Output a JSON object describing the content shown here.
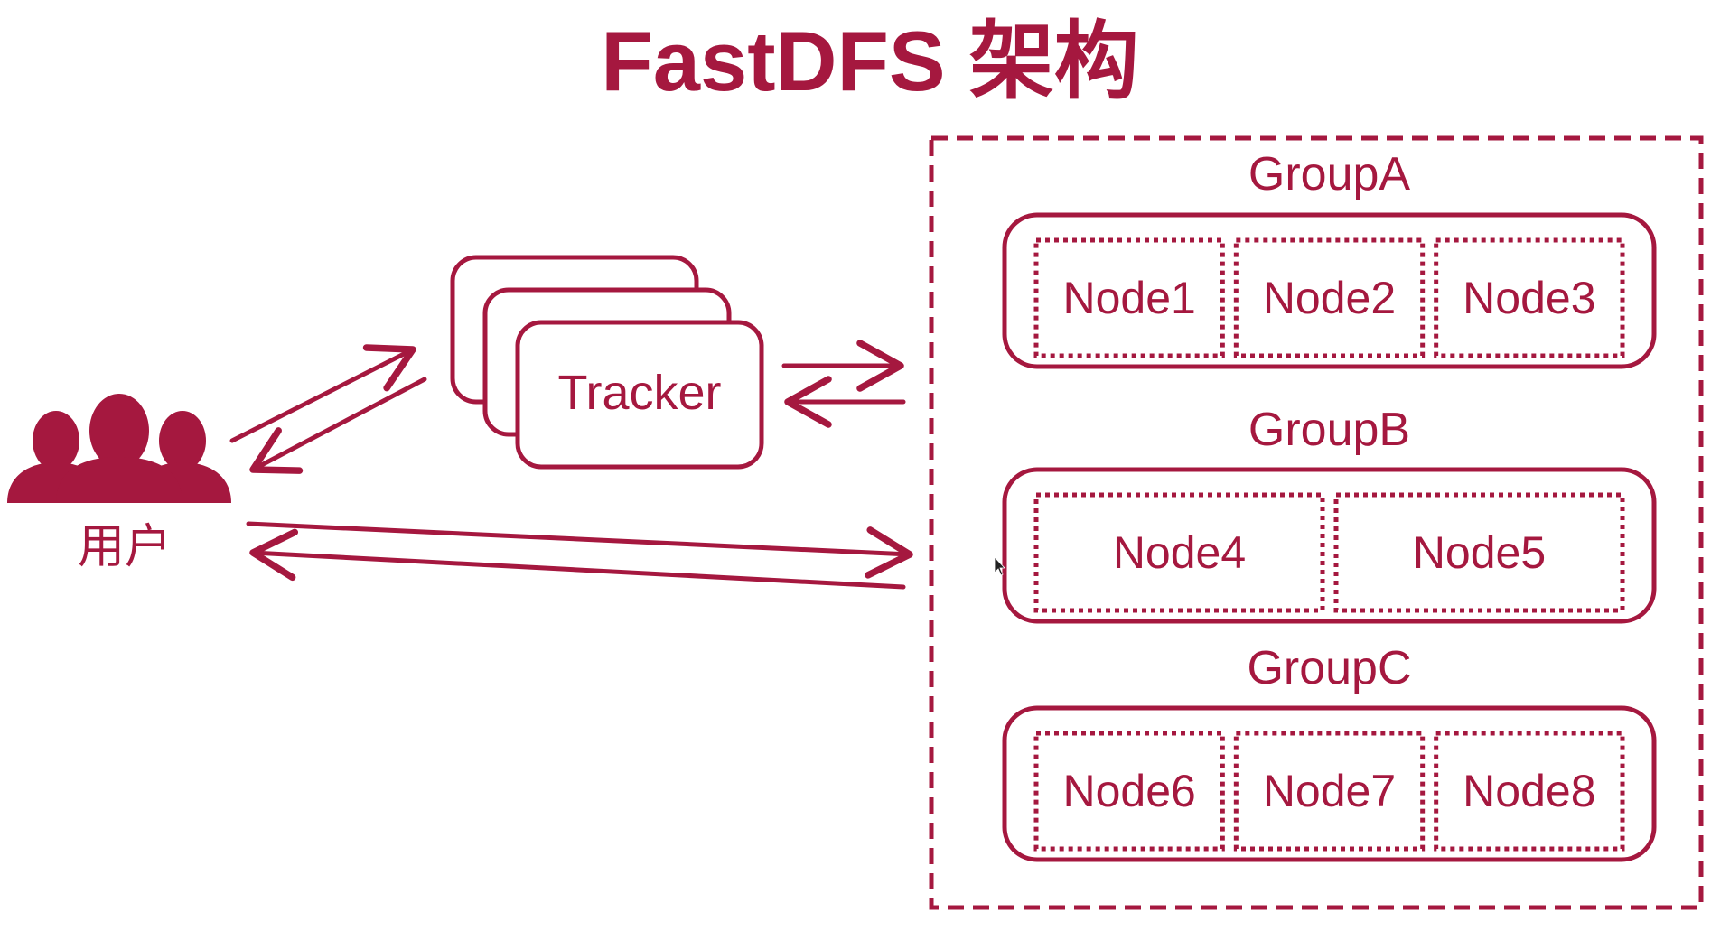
{
  "title": "FastDFS 架构",
  "colors": {
    "primary": "#A5183F",
    "background": "#FFFFFF"
  },
  "user": {
    "label": "用户",
    "icon": "users-group-icon"
  },
  "tracker": {
    "label": "Tracker"
  },
  "storage": {
    "groups": [
      {
        "name": "GroupA",
        "nodes": [
          "Node1",
          "Node2",
          "Node3"
        ]
      },
      {
        "name": "GroupB",
        "nodes": [
          "Node4",
          "Node5"
        ]
      },
      {
        "name": "GroupC",
        "nodes": [
          "Node6",
          "Node7",
          "Node8"
        ]
      }
    ]
  }
}
